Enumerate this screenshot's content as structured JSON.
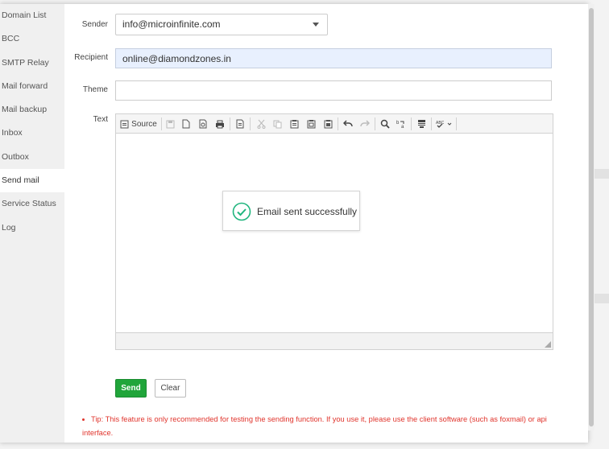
{
  "sidebar": {
    "items": [
      {
        "label": "Domain List"
      },
      {
        "label": "BCC"
      },
      {
        "label": "SMTP Relay"
      },
      {
        "label": "Mail forward"
      },
      {
        "label": "Mail backup"
      },
      {
        "label": "Inbox"
      },
      {
        "label": "Outbox"
      },
      {
        "label": "Send mail",
        "active": true
      },
      {
        "label": "Service Status"
      },
      {
        "label": "Log"
      }
    ]
  },
  "form": {
    "sender_label": "Sender",
    "sender_value": "info@microinfinite.com",
    "recipient_label": "Recipient",
    "recipient_value": "online@diamondzones.in",
    "theme_label": "Theme",
    "theme_value": "",
    "text_label": "Text"
  },
  "editor": {
    "source_label": "Source",
    "toolbar_icons": [
      "save-icon",
      "new-page-icon",
      "preview-icon",
      "print-icon",
      "templates-icon",
      "cut-icon",
      "copy-icon",
      "paste-icon",
      "paste-text-icon",
      "paste-word-icon",
      "undo-icon",
      "redo-icon",
      "find-icon",
      "replace-icon",
      "select-all-icon",
      "spellcheck-icon"
    ]
  },
  "buttons": {
    "send": "Send",
    "clear": "Clear"
  },
  "tip": {
    "text": "Tip: This feature is only recommended for testing the sending function. If you use it, please use the client software (such as foxmail) or api interface."
  },
  "toast": {
    "message": "Email sent successfully"
  },
  "colors": {
    "accent": "#20a53a",
    "tip": "#e0342c",
    "autofill": "#e8f0fe"
  }
}
